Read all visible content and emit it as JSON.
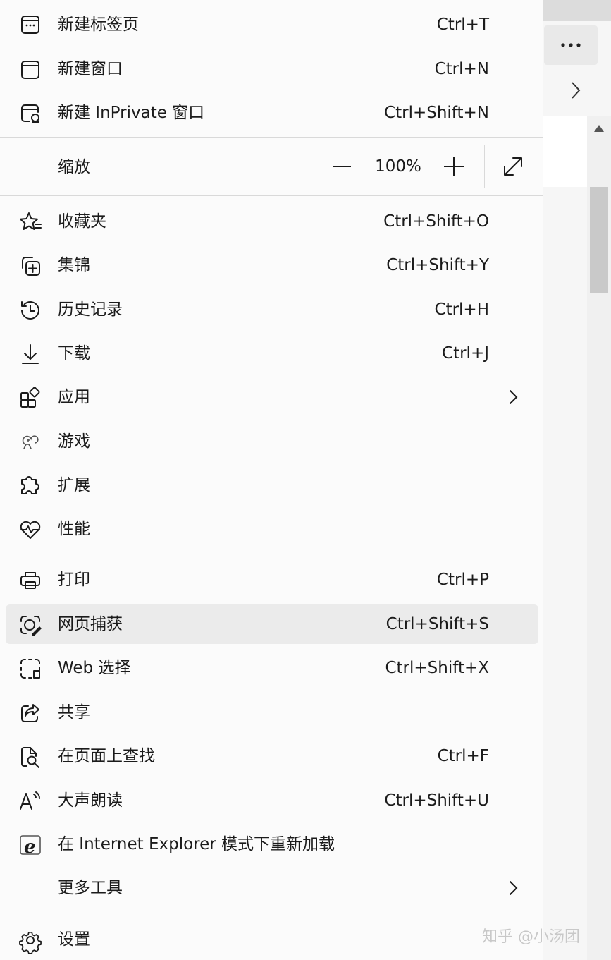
{
  "menu": {
    "items": [
      {
        "label": "新建标签页",
        "shortcut": "Ctrl+T",
        "icon": "new-tab-icon"
      },
      {
        "label": "新建窗口",
        "shortcut": "Ctrl+N",
        "icon": "new-window-icon"
      },
      {
        "label": "新建 InPrivate 窗口",
        "shortcut": "Ctrl+Shift+N",
        "icon": "inprivate-icon"
      },
      {
        "label": "收藏夹",
        "shortcut": "Ctrl+Shift+O",
        "icon": "favorites-star-icon"
      },
      {
        "label": "集锦",
        "shortcut": "Ctrl+Shift+Y",
        "icon": "collections-icon"
      },
      {
        "label": "历史记录",
        "shortcut": "Ctrl+H",
        "icon": "history-icon"
      },
      {
        "label": "下载",
        "shortcut": "Ctrl+J",
        "icon": "download-icon"
      },
      {
        "label": "应用",
        "shortcut": "",
        "icon": "apps-icon"
      },
      {
        "label": "游戏",
        "shortcut": "",
        "icon": "games-icon"
      },
      {
        "label": "扩展",
        "shortcut": "",
        "icon": "extensions-icon"
      },
      {
        "label": "性能",
        "shortcut": "",
        "icon": "performance-icon"
      },
      {
        "label": "打印",
        "shortcut": "Ctrl+P",
        "icon": "print-icon"
      },
      {
        "label": "网页捕获",
        "shortcut": "Ctrl+Shift+S",
        "icon": "web-capture-icon"
      },
      {
        "label": "Web 选择",
        "shortcut": "Ctrl+Shift+X",
        "icon": "web-select-icon"
      },
      {
        "label": "共享",
        "shortcut": "",
        "icon": "share-icon"
      },
      {
        "label": "在页面上查找",
        "shortcut": "Ctrl+F",
        "icon": "find-on-page-icon"
      },
      {
        "label": "大声朗读",
        "shortcut": "Ctrl+Shift+U",
        "icon": "read-aloud-icon"
      },
      {
        "label": "在 Internet Explorer 模式下重新加载",
        "shortcut": "",
        "icon": "ie-mode-icon"
      },
      {
        "label": "更多工具",
        "shortcut": "",
        "icon": ""
      },
      {
        "label": "设置",
        "shortcut": "",
        "icon": "settings-icon"
      }
    ],
    "zoom": {
      "label": "缩放",
      "value": "100%"
    }
  },
  "watermark": "知乎 @小汤团",
  "colors": {
    "menu_bg": "#fbfbfb",
    "hover_bg": "#ebebeb",
    "divider": "#d9d9d9"
  }
}
